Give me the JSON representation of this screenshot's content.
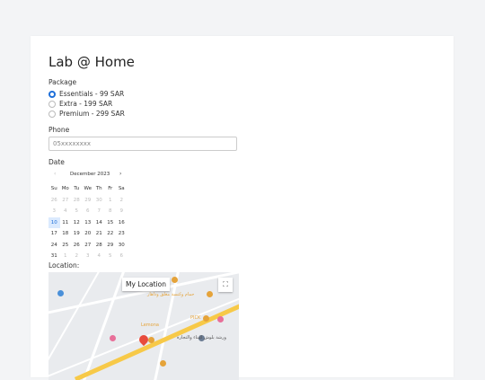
{
  "title": "Lab @ Home",
  "package": {
    "label": "Package",
    "options": [
      {
        "label": "Essentials - 99 SAR",
        "selected": true
      },
      {
        "label": "Extra - 199 SAR",
        "selected": false
      },
      {
        "label": "Premium - 299 SAR",
        "selected": false
      }
    ]
  },
  "phone": {
    "label": "Phone",
    "placeholder": "05xxxxxxxx"
  },
  "date": {
    "label": "Date",
    "prev": "‹",
    "next": "›",
    "month": "December 2023",
    "weekdays": [
      "Su",
      "Mo",
      "Tu",
      "We",
      "Th",
      "Fr",
      "Sa"
    ],
    "weeks": [
      [
        "26",
        "27",
        "28",
        "29",
        "30",
        "1",
        "2"
      ],
      [
        "3",
        "4",
        "5",
        "6",
        "7",
        "8",
        "9"
      ],
      [
        "10",
        "11",
        "12",
        "13",
        "14",
        "15",
        "16"
      ],
      [
        "17",
        "18",
        "19",
        "20",
        "21",
        "22",
        "23"
      ],
      [
        "24",
        "25",
        "26",
        "27",
        "28",
        "29",
        "30"
      ],
      [
        "31",
        "1",
        "2",
        "3",
        "4",
        "5",
        "6"
      ]
    ],
    "today": "10"
  },
  "location": {
    "label": "Location:",
    "my_location": "My Location",
    "fullscreen_icon": "fullscreen-icon",
    "map_labels": {
      "lemona": "Lemona",
      "hammam": "حمام وكنسة مغلق وداهار",
      "pick": "PICK",
      "workshop": "ورشة بلوش للبناء والتجارة"
    }
  },
  "colors": {
    "accent": "#1e6fd9",
    "today_bg": "#dbeafe"
  }
}
